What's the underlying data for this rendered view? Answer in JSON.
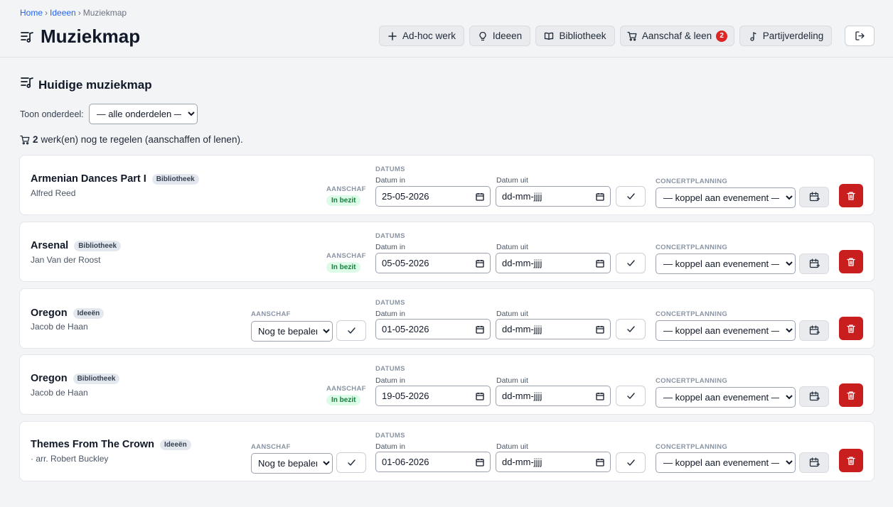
{
  "breadcrumb": {
    "home": "Home",
    "ideas": "Ideeen",
    "current": "Muziekmap",
    "sep": "›"
  },
  "page_title": "Muziekmap",
  "nav": {
    "adhoc": "Ad-hoc werk",
    "ideas": "Ideeen",
    "library": "Bibliotheek",
    "purchase": "Aanschaf & leen",
    "purchase_badge": "2",
    "parts": "Partijverdeling"
  },
  "section_title": "Huidige muziekmap",
  "filter": {
    "label": "Toon onderdeel:",
    "selected": "— alle onderdelen —"
  },
  "info": {
    "count": "2",
    "text": "werk(en) nog te regelen (aanschaffen of lenen)."
  },
  "labels": {
    "acquisition": "AANSCHAF",
    "dates": "DATUMS",
    "date_in": "Datum in",
    "date_out": "Datum uit",
    "concert": "CONCERTPLANNING",
    "date_placeholder": "dd-mm-jjjj",
    "event_placeholder": "— koppel aan evenement —"
  },
  "works": [
    {
      "title": "Armenian Dances Part I",
      "tag": "Bibliotheek",
      "composer": "Alfred Reed",
      "status": "In bezit",
      "date_in": "25-05-2026"
    },
    {
      "title": "Arsenal",
      "tag": "Bibliotheek",
      "composer": "Jan Van der Roost",
      "status": "In bezit",
      "date_in": "05-05-2026"
    },
    {
      "title": "Oregon",
      "tag": "Ideeën",
      "composer": "Jacob de Haan",
      "acquisition": "Nog te bepalen",
      "date_in": "01-05-2026"
    },
    {
      "title": "Oregon",
      "tag": "Bibliotheek",
      "composer": "Jacob de Haan",
      "status": "In bezit",
      "date_in": "19-05-2026"
    },
    {
      "title": "Themes From The Crown",
      "tag": "Ideeën",
      "composer": "· arr. Robert Buckley",
      "acquisition": "Nog te bepalen",
      "date_in": "01-06-2026"
    }
  ]
}
